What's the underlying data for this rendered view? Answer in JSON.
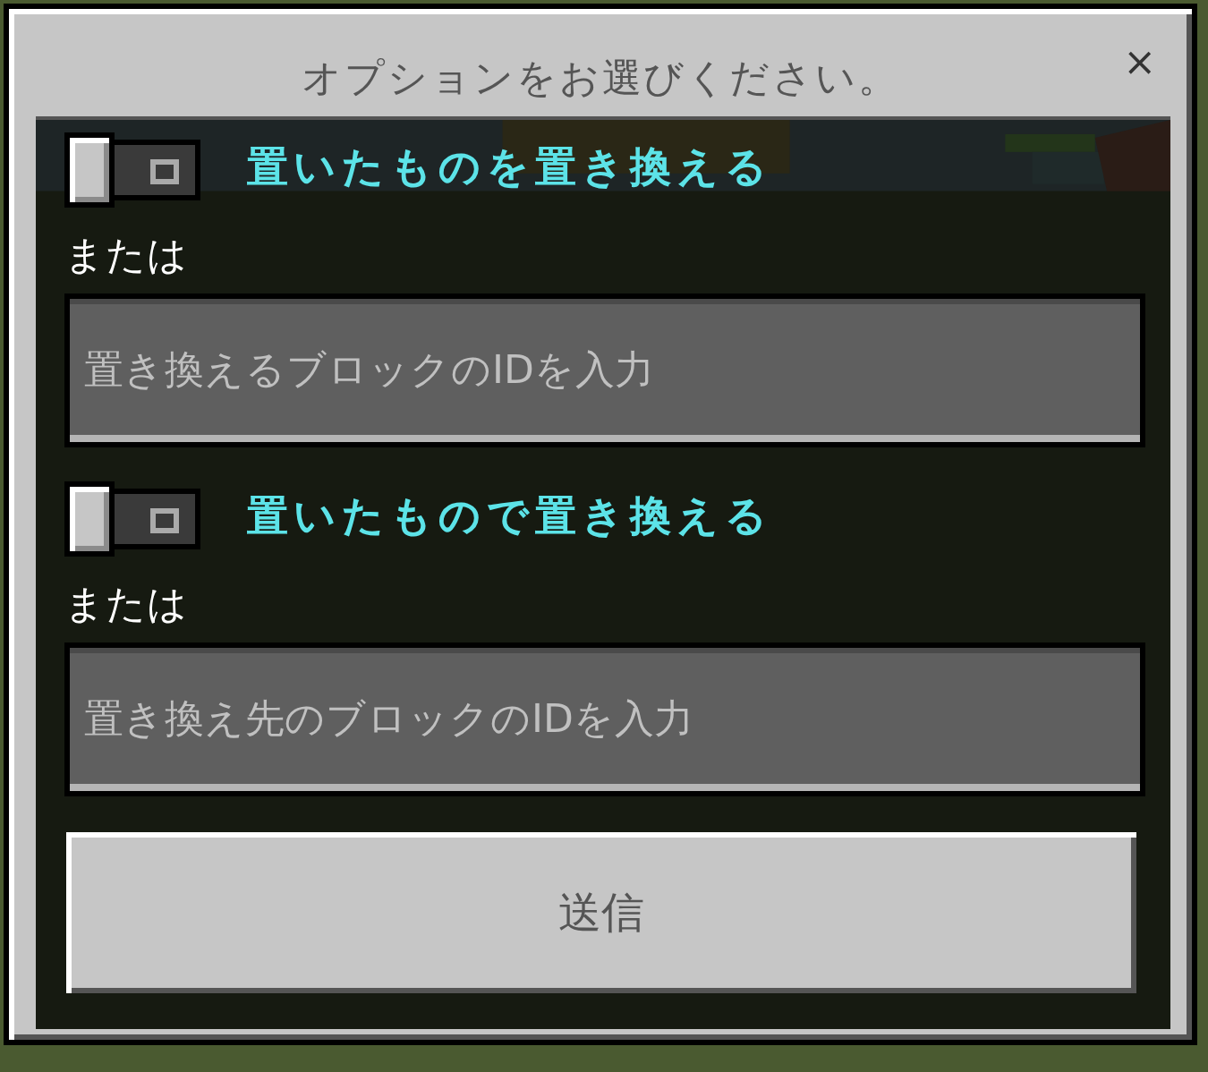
{
  "window": {
    "title": "オプションをお選びください。",
    "close": "×"
  },
  "controls": [
    {
      "kind": "toggle",
      "label": "置いたものを置き換える",
      "on": false
    },
    {
      "kind": "input",
      "label": "または",
      "placeholder": "置き換えるブロックのIDを入力"
    },
    {
      "kind": "toggle",
      "label": "置いたもので置き換える",
      "on": false
    },
    {
      "kind": "input",
      "label": "または",
      "placeholder": "置き換え先のブロックのIDを入力"
    }
  ],
  "submit": "送信"
}
